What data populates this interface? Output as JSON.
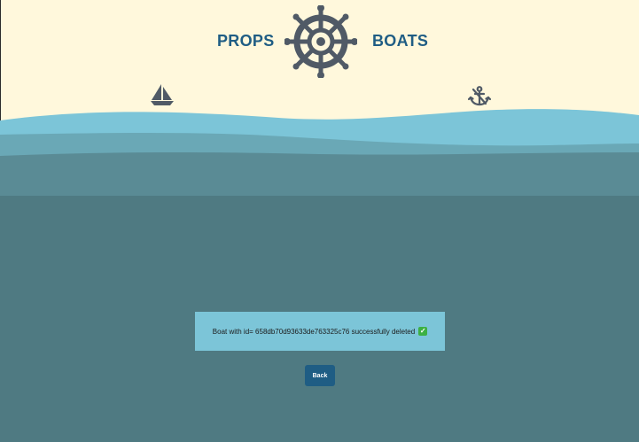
{
  "header": {
    "left_text": "PROPS",
    "right_text": "BOATS",
    "logo_icon": "ship-wheel-icon"
  },
  "decor": {
    "boat_icon": "sailboat-icon",
    "anchor_icon": "anchor-icon"
  },
  "message": {
    "text": "Boat with id= 658db70d93633de763325c76 successfully deleted",
    "status_icon": "check-mark-icon",
    "status_glyph": "✓"
  },
  "actions": {
    "back_label": "Back"
  },
  "colors": {
    "sky": "#fff8dc",
    "brand": "#1f5d84",
    "sea_light": "#7cc5d8",
    "sea_mid": "#6aa8b6",
    "sea_dark": "#5a8b95",
    "sea_deep": "#4f7a82",
    "icon": "#505a66",
    "success": "#3cb043"
  }
}
